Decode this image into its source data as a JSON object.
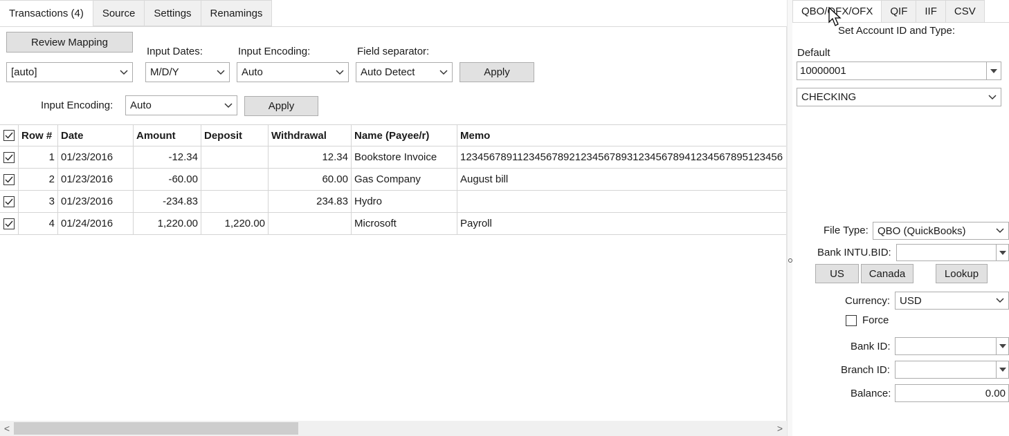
{
  "left_tabs": [
    "Transactions (4)",
    "Source",
    "Settings",
    "Renamings"
  ],
  "toolbar": {
    "review_mapping": "Review Mapping",
    "profile_value": "[auto]",
    "input_dates_label": "Input Dates:",
    "input_dates_value": "M/D/Y",
    "input_encoding_label": "Input Encoding:",
    "input_encoding_value": "Auto",
    "field_separator_label": "Field separator:",
    "field_separator_value": "Auto Detect",
    "apply_label": "Apply",
    "input_encoding2_label": "Input Encoding:",
    "input_encoding2_value": "Auto",
    "apply2_label": "Apply"
  },
  "grid": {
    "columns": [
      "Row #",
      "Date",
      "Amount",
      "Deposit",
      "Withdrawal",
      "Name (Payee/r)",
      "Memo"
    ],
    "rows": [
      {
        "row": "1",
        "date": "01/23/2016",
        "amount": "-12.34",
        "deposit": "",
        "withdrawal": "12.34",
        "name": "Bookstore Invoice",
        "memo": "12345678911234567892123456789312345678941234567895123456"
      },
      {
        "row": "2",
        "date": "01/23/2016",
        "amount": "-60.00",
        "deposit": "",
        "withdrawal": "60.00",
        "name": "Gas Company",
        "memo": "August bill"
      },
      {
        "row": "3",
        "date": "01/23/2016",
        "amount": "-234.83",
        "deposit": "",
        "withdrawal": "234.83",
        "name": "Hydro",
        "memo": ""
      },
      {
        "row": "4",
        "date": "01/24/2016",
        "amount": "1,220.00",
        "deposit": "1,220.00",
        "withdrawal": "",
        "name": "Microsoft",
        "memo": "Payroll"
      }
    ]
  },
  "scrollbar": {
    "left_arrow": "<",
    "right_arrow": ">"
  },
  "right_tabs": [
    "QBO/QFX/OFX",
    "QIF",
    "IIF",
    "CSV"
  ],
  "account": {
    "heading": "Set Account ID and Type:",
    "default_label": "Default",
    "account_id": "10000001",
    "account_type": "CHECKING"
  },
  "export": {
    "file_type_label": "File Type:",
    "file_type_value": "QBO (QuickBooks)",
    "bank_intu_label": "Bank INTU.BID:",
    "bank_intu_value": "",
    "us_label": "US",
    "canada_label": "Canada",
    "lookup_label": "Lookup",
    "currency_label": "Currency:",
    "currency_value": "USD",
    "force_label": "Force",
    "bank_id_label": "Bank ID:",
    "bank_id_value": "",
    "branch_id_label": "Branch ID:",
    "branch_id_value": "",
    "balance_label": "Balance:",
    "balance_value": "0.00"
  },
  "icons": {
    "checkbox_checked": "check-icon",
    "dropdown": "chevron-down-icon",
    "cursor": "mouse-pointer-icon"
  }
}
